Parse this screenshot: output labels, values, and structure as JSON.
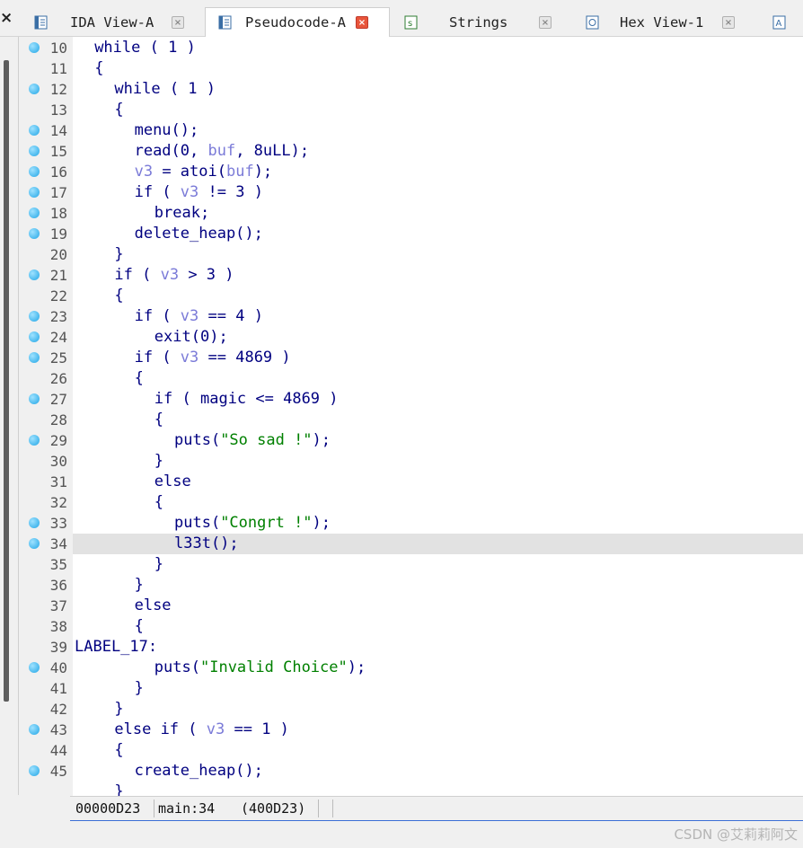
{
  "tabs": [
    {
      "label": "IDA View-A",
      "icon": "disassembly-icon",
      "active": false
    },
    {
      "label": "Pseudocode-A",
      "icon": "pseudocode-icon",
      "active": true
    },
    {
      "label": "Strings",
      "icon": "strings-icon",
      "active": false
    },
    {
      "label": "Hex View-1",
      "icon": "hex-view-icon",
      "active": false
    },
    {
      "label": "",
      "icon": "structures-icon",
      "active": false
    }
  ],
  "close_glyph": "×",
  "code_lines": [
    {
      "n": "10",
      "bp": true,
      "indent": 1,
      "tokens": [
        [
          "while",
          "kw"
        ],
        [
          " ( ",
          "p"
        ],
        [
          "1",
          "num"
        ],
        [
          " )",
          "p"
        ]
      ]
    },
    {
      "n": "11",
      "bp": false,
      "indent": 1,
      "tokens": [
        [
          "{",
          "p"
        ]
      ]
    },
    {
      "n": "12",
      "bp": true,
      "indent": 2,
      "tokens": [
        [
          "while",
          "kw"
        ],
        [
          " ( ",
          "p"
        ],
        [
          "1",
          "num"
        ],
        [
          " )",
          "p"
        ]
      ]
    },
    {
      "n": "13",
      "bp": false,
      "indent": 2,
      "tokens": [
        [
          "{",
          "p"
        ]
      ]
    },
    {
      "n": "14",
      "bp": true,
      "indent": 3,
      "tokens": [
        [
          "menu();",
          "p"
        ]
      ]
    },
    {
      "n": "15",
      "bp": true,
      "indent": 3,
      "tokens": [
        [
          "read(0, ",
          "p"
        ],
        [
          "buf",
          "var"
        ],
        [
          ", 8uLL);",
          "p"
        ]
      ]
    },
    {
      "n": "16",
      "bp": true,
      "indent": 3,
      "tokens": [
        [
          "v3",
          "var"
        ],
        [
          " = atoi(",
          "p"
        ],
        [
          "buf",
          "var"
        ],
        [
          ");",
          "p"
        ]
      ]
    },
    {
      "n": "17",
      "bp": true,
      "indent": 3,
      "tokens": [
        [
          "if",
          "kw"
        ],
        [
          " ( ",
          "p"
        ],
        [
          "v3",
          "var"
        ],
        [
          " != 3 )",
          "p"
        ]
      ]
    },
    {
      "n": "18",
      "bp": true,
      "indent": 4,
      "tokens": [
        [
          "break;",
          "kw"
        ]
      ]
    },
    {
      "n": "19",
      "bp": true,
      "indent": 3,
      "tokens": [
        [
          "delete_heap();",
          "p"
        ]
      ]
    },
    {
      "n": "20",
      "bp": false,
      "indent": 2,
      "tokens": [
        [
          "}",
          "p"
        ]
      ]
    },
    {
      "n": "21",
      "bp": true,
      "indent": 2,
      "tokens": [
        [
          "if",
          "kw"
        ],
        [
          " ( ",
          "p"
        ],
        [
          "v3",
          "var"
        ],
        [
          " > 3 )",
          "p"
        ]
      ]
    },
    {
      "n": "22",
      "bp": false,
      "indent": 2,
      "tokens": [
        [
          "{",
          "p"
        ]
      ]
    },
    {
      "n": "23",
      "bp": true,
      "indent": 3,
      "tokens": [
        [
          "if",
          "kw"
        ],
        [
          " ( ",
          "p"
        ],
        [
          "v3",
          "var"
        ],
        [
          " == 4 )",
          "p"
        ]
      ]
    },
    {
      "n": "24",
      "bp": true,
      "indent": 4,
      "tokens": [
        [
          "exit(0);",
          "p"
        ]
      ]
    },
    {
      "n": "25",
      "bp": true,
      "indent": 3,
      "tokens": [
        [
          "if",
          "kw"
        ],
        [
          " ( ",
          "p"
        ],
        [
          "v3",
          "var"
        ],
        [
          " == 4869 )",
          "p"
        ]
      ]
    },
    {
      "n": "26",
      "bp": false,
      "indent": 3,
      "tokens": [
        [
          "{",
          "p"
        ]
      ]
    },
    {
      "n": "27",
      "bp": true,
      "indent": 4,
      "tokens": [
        [
          "if",
          "kw"
        ],
        [
          " ( magic <= 4869 )",
          "p"
        ]
      ]
    },
    {
      "n": "28",
      "bp": false,
      "indent": 4,
      "tokens": [
        [
          "{",
          "p"
        ]
      ]
    },
    {
      "n": "29",
      "bp": true,
      "indent": 5,
      "tokens": [
        [
          "puts(",
          "p"
        ],
        [
          "\"So sad !\"",
          "str"
        ],
        [
          ");",
          "p"
        ]
      ]
    },
    {
      "n": "30",
      "bp": false,
      "indent": 4,
      "tokens": [
        [
          "}",
          "p"
        ]
      ]
    },
    {
      "n": "31",
      "bp": false,
      "indent": 4,
      "tokens": [
        [
          "else",
          "kw"
        ]
      ]
    },
    {
      "n": "32",
      "bp": false,
      "indent": 4,
      "tokens": [
        [
          "{",
          "p"
        ]
      ]
    },
    {
      "n": "33",
      "bp": true,
      "indent": 5,
      "tokens": [
        [
          "puts(",
          "p"
        ],
        [
          "\"Congrt !\"",
          "str"
        ],
        [
          ");",
          "p"
        ]
      ]
    },
    {
      "n": "34",
      "bp": true,
      "indent": 5,
      "tokens": [
        [
          "l33t();",
          "p"
        ]
      ],
      "highlight": true
    },
    {
      "n": "35",
      "bp": false,
      "indent": 4,
      "tokens": [
        [
          "}",
          "p"
        ]
      ]
    },
    {
      "n": "36",
      "bp": false,
      "indent": 3,
      "tokens": [
        [
          "}",
          "p"
        ]
      ]
    },
    {
      "n": "37",
      "bp": false,
      "indent": 3,
      "tokens": [
        [
          "else",
          "kw"
        ]
      ]
    },
    {
      "n": "38",
      "bp": false,
      "indent": 3,
      "tokens": [
        [
          "{",
          "p"
        ]
      ]
    },
    {
      "n": "39",
      "bp": false,
      "indent": 0,
      "tokens": [
        [
          "LABEL_17:",
          "p"
        ]
      ]
    },
    {
      "n": "40",
      "bp": true,
      "indent": 4,
      "tokens": [
        [
          "puts(",
          "p"
        ],
        [
          "\"Invalid Choice\"",
          "str"
        ],
        [
          ");",
          "p"
        ]
      ]
    },
    {
      "n": "41",
      "bp": false,
      "indent": 3,
      "tokens": [
        [
          "}",
          "p"
        ]
      ]
    },
    {
      "n": "42",
      "bp": false,
      "indent": 2,
      "tokens": [
        [
          "}",
          "p"
        ]
      ]
    },
    {
      "n": "43",
      "bp": true,
      "indent": 2,
      "tokens": [
        [
          "else if",
          "kw"
        ],
        [
          " ( ",
          "p"
        ],
        [
          "v3",
          "var"
        ],
        [
          " == 1 )",
          "p"
        ]
      ]
    },
    {
      "n": "44",
      "bp": false,
      "indent": 2,
      "tokens": [
        [
          "{",
          "p"
        ]
      ]
    },
    {
      "n": "45",
      "bp": true,
      "indent": 3,
      "tokens": [
        [
          "create_heap();",
          "p"
        ]
      ]
    },
    {
      "n": "",
      "bp": false,
      "indent": 2,
      "tokens": [
        [
          "}",
          "p"
        ]
      ]
    }
  ],
  "status": {
    "address": "00000D23",
    "location": "main:34",
    "full_address": "(400D23)"
  },
  "watermark": "CSDN @艾莉莉阿文",
  "colors": {
    "keyword": "#000080",
    "variable": "#7b7bd8",
    "string": "#008000",
    "breakpoint": "#21a6e6",
    "highlight": "#e2e2e2"
  }
}
